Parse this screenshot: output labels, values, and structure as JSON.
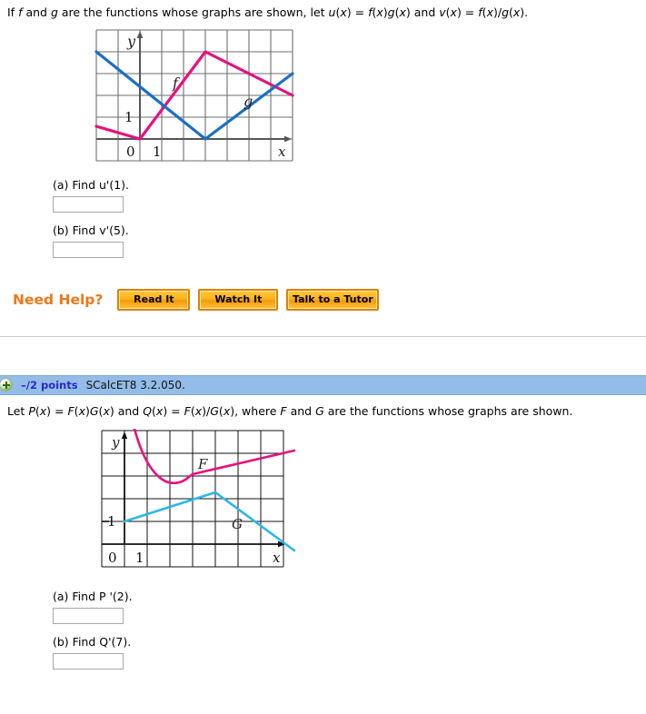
{
  "colors": {
    "magenta": "#E5127D",
    "blue1": "#1B6FC4",
    "blue2": "#2BB8E8",
    "grid": "#6E6E6E",
    "grid2": "#111111",
    "bar_bg": "#93BDE8",
    "points_text": "#2B29C4",
    "help_title": "#F07818",
    "button_border": "#E08000"
  },
  "problem1": {
    "statement": "If f and g are the functions whose graphs are shown, let u(x) = f(x)g(x) and v(x) = f(x)/g(x).",
    "graph": {
      "axis_y_label": "y",
      "axis_x_label": "x",
      "origin_label": "0",
      "tick_x_label": "1",
      "tick_y_label": "1",
      "curve_f_label": "f",
      "curve_g_label": "g"
    },
    "parts": [
      {
        "label": "(a) Find u'(1).",
        "value": "",
        "placeholder": ""
      },
      {
        "label": "(b) Find v'(5).",
        "value": "",
        "placeholder": ""
      }
    ],
    "need_help": {
      "title": "Need Help?",
      "buttons": [
        "Read It",
        "Watch It",
        "Talk to a Tutor"
      ]
    }
  },
  "problem2": {
    "points_label": "–/2 points",
    "reference": "SCalcET8 3.2.050.",
    "statement": "Let P(x) = F(x)G(x) and Q(x) = F(x)/G(x), where F and G are the functions whose graphs are shown.",
    "graph": {
      "axis_y_label": "y",
      "axis_x_label": "x",
      "origin_label": "0",
      "tick_x_label": "1",
      "tick_y_label": "1",
      "curve_F_label": "F",
      "curve_G_label": "G"
    },
    "parts": [
      {
        "label": "(a) Find P '(2).",
        "value": "",
        "placeholder": ""
      },
      {
        "label": "(b) Find Q'(7).",
        "value": "",
        "placeholder": ""
      }
    ]
  },
  "chart_data": [
    {
      "type": "line",
      "title": "Graphs of f and g",
      "xlabel": "x",
      "ylabel": "y",
      "xlim": [
        -2,
        8
      ],
      "ylim": [
        -1,
        5
      ],
      "grid": true,
      "legend": "inline-labels",
      "series": [
        {
          "name": "f",
          "color": "#E5127D",
          "points": [
            [
              -2,
              0.6
            ],
            [
              0,
              0
            ],
            [
              3,
              4
            ],
            [
              8,
              2
            ]
          ]
        },
        {
          "name": "g",
          "color": "#1B6FC4",
          "points": [
            [
              -2,
              4
            ],
            [
              3,
              0
            ],
            [
              8,
              2.5
            ]
          ]
        }
      ]
    },
    {
      "type": "line",
      "title": "Graphs of F and G",
      "xlabel": "x",
      "ylabel": "y",
      "xlim": [
        -1,
        9
      ],
      "ylim": [
        -1,
        5
      ],
      "grid": true,
      "legend": "inline-labels",
      "series": [
        {
          "name": "F",
          "color": "#E5127D",
          "shape": "parabola-then-line",
          "points": [
            [
              0.3,
              5
            ],
            [
              1,
              3.2
            ],
            [
              2,
              2.45
            ],
            [
              3,
              3
            ],
            [
              9,
              4
            ]
          ]
        },
        {
          "name": "G",
          "color": "#2BB8E8",
          "points": [
            [
              0,
              1
            ],
            [
              4,
              3
            ],
            [
              9,
              0.3
            ]
          ]
        }
      ]
    }
  ]
}
